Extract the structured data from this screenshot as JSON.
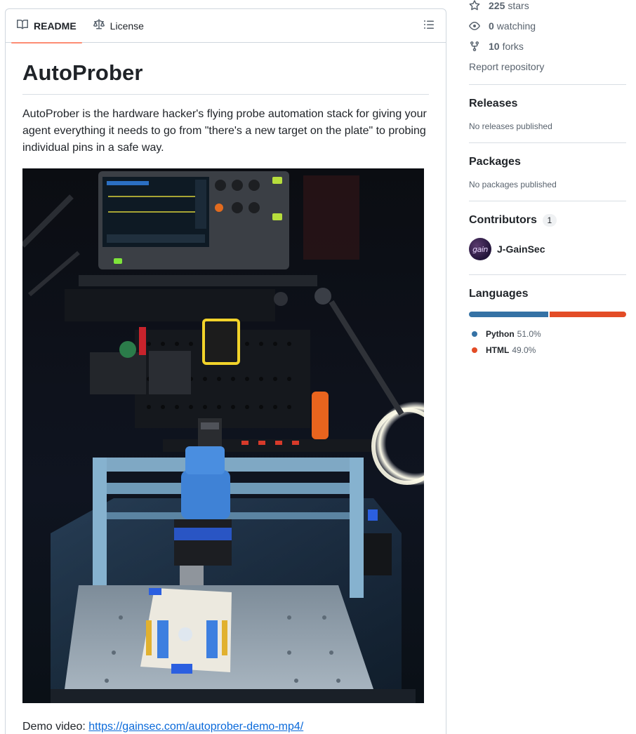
{
  "readme": {
    "tabs": [
      {
        "label": "README",
        "selected": true,
        "icon": "book-icon"
      },
      {
        "label": "License",
        "selected": false,
        "icon": "law-icon"
      }
    ],
    "title": "AutoProber",
    "intro": "AutoProber is the hardware hacker's flying probe automation stack for giving your agent everything it needs to go from \"there's a new target on the plate\" to probing individual pins in a safe way.",
    "demo_label": "Demo video:",
    "demo_link": "https://gainsec.com/autoprober-demo-mp4/"
  },
  "sidebar": {
    "stars_count": "225",
    "stars_label": "stars",
    "watching_count": "0",
    "watching_label": "watching",
    "forks_count": "10",
    "forks_label": "forks",
    "report": "Report repository",
    "releases": {
      "title": "Releases",
      "empty": "No releases published"
    },
    "packages": {
      "title": "Packages",
      "empty": "No packages published"
    },
    "contributors": {
      "title": "Contributors",
      "count": "1",
      "items": [
        {
          "name": "J-GainSec",
          "avatar_text": "gain"
        }
      ]
    },
    "languages": {
      "title": "Languages",
      "items": [
        {
          "name": "Python",
          "percent": "51.0%",
          "value": 51.0,
          "color": "#3572A5"
        },
        {
          "name": "HTML",
          "percent": "49.0%",
          "value": 49.0,
          "color": "#e34c26"
        }
      ]
    }
  },
  "colors": {
    "accent_tab": "#fd8c73",
    "link": "#0969da",
    "border": "#d0d7de"
  }
}
